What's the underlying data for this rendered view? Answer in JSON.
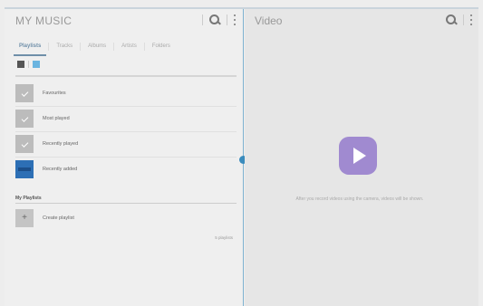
{
  "music": {
    "title": "MY MUSIC",
    "tabs": [
      "Playlists",
      "Tracks",
      "Albums",
      "Artists",
      "Folders"
    ],
    "active_tab": "Playlists",
    "items": [
      {
        "label": "Favourites",
        "thumb": "checkbox"
      },
      {
        "label": "Most played",
        "thumb": "checkbox"
      },
      {
        "label": "Recently played",
        "thumb": "checkbox"
      },
      {
        "label": "Recently added",
        "thumb": "album-art"
      }
    ],
    "section_header": "My Playlists",
    "create_label": "Create playlist",
    "count_label": "5 playlists"
  },
  "video": {
    "title": "Video",
    "empty_message": "After you record videos using the camera, videos will be shown."
  },
  "colors": {
    "accent": "#6f8fa9",
    "divider": "#7fb3d1",
    "handle": "#3b8cbd",
    "video_tile": "#a08ad0",
    "album_thumb": "#2d6fb5"
  },
  "icons": [
    "search-icon",
    "more-options-icon",
    "list-view-icon",
    "grid-view-icon",
    "check-icon",
    "add-icon",
    "play-icon"
  ]
}
